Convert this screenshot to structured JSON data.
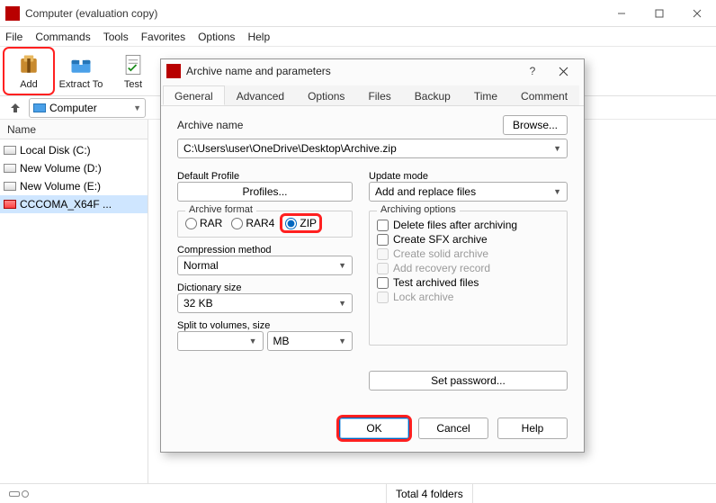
{
  "window": {
    "title": "Computer (evaluation copy)"
  },
  "menubar": [
    "File",
    "Commands",
    "Tools",
    "Favorites",
    "Options",
    "Help"
  ],
  "toolbar": {
    "add": "Add",
    "extract": "Extract To",
    "test": "Test"
  },
  "addressbar": {
    "location": "Computer"
  },
  "tree": {
    "header": "Name",
    "items": [
      {
        "label": "Local Disk (C:)"
      },
      {
        "label": "New Volume (D:)"
      },
      {
        "label": "New Volume (E:)"
      },
      {
        "label": "CCCOMA_X64F ...",
        "selected": true
      }
    ]
  },
  "statusbar": {
    "total": "Total 4 folders"
  },
  "dialog": {
    "title": "Archive name and parameters",
    "tabs": [
      "General",
      "Advanced",
      "Options",
      "Files",
      "Backup",
      "Time",
      "Comment"
    ],
    "active_tab": "General",
    "archive_name_label": "Archive name",
    "browse": "Browse...",
    "archive_name_value": "C:\\Users\\user\\OneDrive\\Desktop\\Archive.zip",
    "default_profile_label": "Default Profile",
    "profiles_btn": "Profiles...",
    "update_mode_label": "Update mode",
    "update_mode_value": "Add and replace files",
    "archive_format_legend": "Archive format",
    "fmt_rar": "RAR",
    "fmt_rar4": "RAR4",
    "fmt_zip": "ZIP",
    "compression_label": "Compression method",
    "compression_value": "Normal",
    "dict_label": "Dictionary size",
    "dict_value": "32 KB",
    "split_label": "Split to volumes, size",
    "split_unit": "MB",
    "arch_opts_legend": "Archiving options",
    "opt_delete": "Delete files after archiving",
    "opt_sfx": "Create SFX archive",
    "opt_solid": "Create solid archive",
    "opt_recovery": "Add recovery record",
    "opt_test": "Test archived files",
    "opt_lock": "Lock archive",
    "set_password": "Set password...",
    "ok": "OK",
    "cancel": "Cancel",
    "help": "Help"
  }
}
